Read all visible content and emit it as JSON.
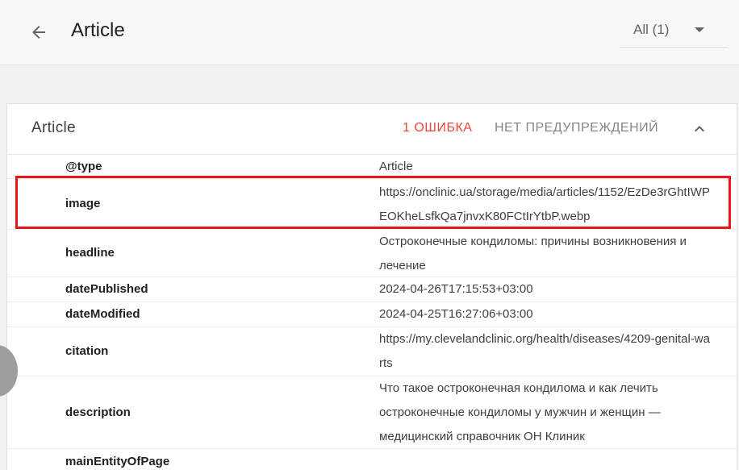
{
  "header": {
    "title": "Article",
    "filter_value": "All (1)"
  },
  "card": {
    "title": "Article",
    "errors_label": "1 ОШИБКА",
    "warnings_label": "НЕТ ПРЕДУПРЕЖДЕНИЙ"
  },
  "rows": [
    {
      "property": "@type",
      "value": "Article"
    },
    {
      "property": "image",
      "value": "https://onclinic.ua/storage/media/articles/1152/EzDe3rGhtIWPEOKheLsfkQa7jnvxK80FCtIrYtbP.webp"
    },
    {
      "property": "headline",
      "value": "Остроконечные кондиломы: причины возникновения и лечение"
    },
    {
      "property": "datePublished",
      "value": "2024-04-26T17:15:53+03:00"
    },
    {
      "property": "dateModified",
      "value": "2024-04-25T16:27:06+03:00"
    },
    {
      "property": "citation",
      "value": "https://my.clevelandclinic.org/health/diseases/4209-genital-warts"
    },
    {
      "property": "description",
      "value": "Что такое остроконечная кондилома и как лечить остроконечные кондиломы у мужчин и женщин — медицинский справочник ОН Клиник"
    },
    {
      "property": "mainEntityOfPage",
      "value": ""
    }
  ],
  "icons": {
    "back": "arrow-back-icon",
    "collapse": "chevron-up-icon",
    "dropdown": "caret-down-icon"
  },
  "colors": {
    "error": "#e8453c",
    "highlight": "#e8151b"
  }
}
